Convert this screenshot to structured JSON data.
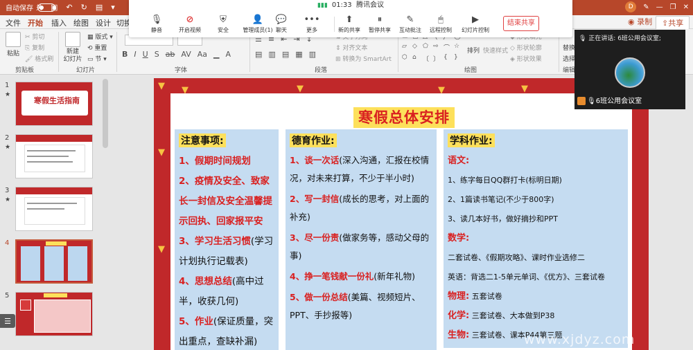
{
  "titlebar": {
    "autosave_label": "自动保存",
    "autosave_state": "关",
    "user_initial": "D",
    "record_label": "录制",
    "share_label": "共享"
  },
  "ribbon_tabs": [
    "文件",
    "开始",
    "插入",
    "绘图",
    "设计",
    "切换"
  ],
  "ribbon": {
    "paste": "粘贴",
    "cut": "剪切",
    "copy": "复制",
    "format_painter": "格式刷",
    "clipboard_group": "剪贴板",
    "new_slide": "新建\n幻灯片",
    "layout": "版式",
    "reset": "重置",
    "section": "节",
    "slides_group": "幻灯片",
    "font_group": "字体",
    "text_direction": "文字方向",
    "align_text": "对齐文本",
    "smartart": "转换为 SmartArt",
    "paragraph_group": "段落",
    "arrange": "排列",
    "quick_styles": "快速样式",
    "shape_fill": "形状填充",
    "shape_outline": "形状轮廓",
    "shape_effect": "形状效果",
    "drawing_group": "绘图",
    "edit_group": "编辑",
    "replace": "替换",
    "select": "选择"
  },
  "meeting": {
    "time": "01:33",
    "app_name": "腾讯会议",
    "buttons": [
      {
        "label": "静音"
      },
      {
        "label": "开启视频"
      },
      {
        "label": "安全"
      },
      {
        "label": "管理成员(1)"
      },
      {
        "label": "聊天"
      },
      {
        "label": "更多"
      },
      {
        "label": "新的共享"
      },
      {
        "label": "暂停共享"
      },
      {
        "label": "互动批注"
      },
      {
        "label": "远程控制"
      },
      {
        "label": "幻灯片控制"
      }
    ],
    "end_share": "结束共享"
  },
  "speaker": {
    "speaking_text": "正在讲话: 6班公用会议室;",
    "name": "6班公用会议室"
  },
  "slide_numbers": [
    "1",
    "2",
    "3",
    "4",
    "5"
  ],
  "thumb1_title": "寒假生活指南",
  "slide": {
    "title": "寒假总体安排",
    "col1": {
      "header": "注意事项:",
      "items": [
        {
          "red": "1、假期时间规划",
          "black": ""
        },
        {
          "red": "2、疫情及安全、致家长一封信及安全温馨提示回执、回家报平安",
          "black": ""
        },
        {
          "red": "3、学习生活习惯",
          "black": "(学习计划执行记载表)"
        },
        {
          "red": "4、思想总结",
          "black": "(高中过半，收获几何)"
        },
        {
          "red": "5、作业",
          "black": "(保证质量，突出重点，查缺补漏)"
        }
      ]
    },
    "col2": {
      "header": "德育作业:",
      "items": [
        {
          "red": "1、谈一次话",
          "black": "(深入沟通，汇报在校情况，对未来打算，不少于半小时)"
        },
        {
          "red": "2、写一封信",
          "black": "(成长的思考，对上面的补充)"
        },
        {
          "red": "3、尽一份责",
          "black": "(做家务等，感动父母的事)"
        },
        {
          "red": "4、挣一笔钱献一份礼",
          "black": "(新年礼物)"
        },
        {
          "red": "5、做一份总结",
          "black": "(美篇、视频短片、PPT、手抄报等)"
        }
      ]
    },
    "col3": {
      "header": "学科作业:",
      "chinese_label": "语文:",
      "chinese_items": [
        "1、练字每日QQ群打卡(标明日期)",
        "2、1篇读书笔记(不少于800字)",
        "3、读几本好书，做好摘抄和PPT"
      ],
      "math_label": "数学:",
      "math_text": "二套试卷、《假期攻略》、课时作业选修二",
      "english_text": "英语：背选二1-5单元单词、《优方》、三套试卷",
      "physics_label": "物理:",
      "physics_text": "五套试卷",
      "chemistry_label": "化学:",
      "chemistry_text": "三套试卷、大本做到P38",
      "biology_label": "生物:",
      "biology_text": "三套试卷、课本P44第三题"
    }
  },
  "watermark": "www.xjdyz.com"
}
